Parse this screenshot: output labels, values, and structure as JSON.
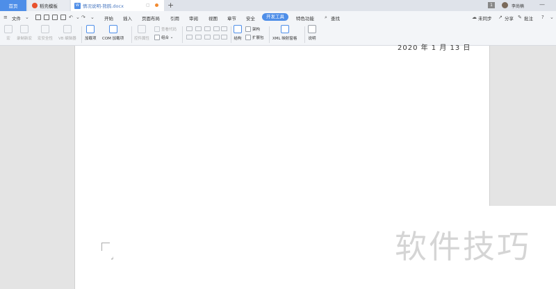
{
  "tabs": {
    "home": "首页",
    "template": "稻壳模板",
    "document": "情况说明-熊鸥.docx",
    "doc_badge": "W"
  },
  "titlebar": {
    "window_number": "1",
    "username": "李尚楠"
  },
  "menu": {
    "file": "文件",
    "items": [
      "开始",
      "插入",
      "页面布局",
      "引用",
      "审阅",
      "视图",
      "章节",
      "安全",
      "开发工具",
      "特色功能"
    ],
    "active": "开发工具",
    "search": "查找",
    "sync": "未同步",
    "share": "分享",
    "comment": "批注"
  },
  "toolbar": {
    "macro": "宏",
    "record_macro": "录制新宏",
    "macro_security": "宏安全性",
    "vb_editor": "VB 编辑器",
    "addins": "加载项",
    "com_addins": "COM 加载项",
    "control_properties": "控件属性",
    "view_code": "查看代码",
    "group": "组合",
    "structure": "结构",
    "schema": "架构",
    "expansion_pack": "扩展包",
    "xml_mapping": "XML 映射窗格",
    "help": "说明"
  },
  "document": {
    "date_text": "2020 年 1 月 13 日",
    "para_mark": "↲"
  },
  "watermark": "软件技巧",
  "colors": {
    "accent": "#4e8ee8",
    "ribbon_bg": "#f3f5f8",
    "workspace_bg": "#e4e4e4"
  }
}
